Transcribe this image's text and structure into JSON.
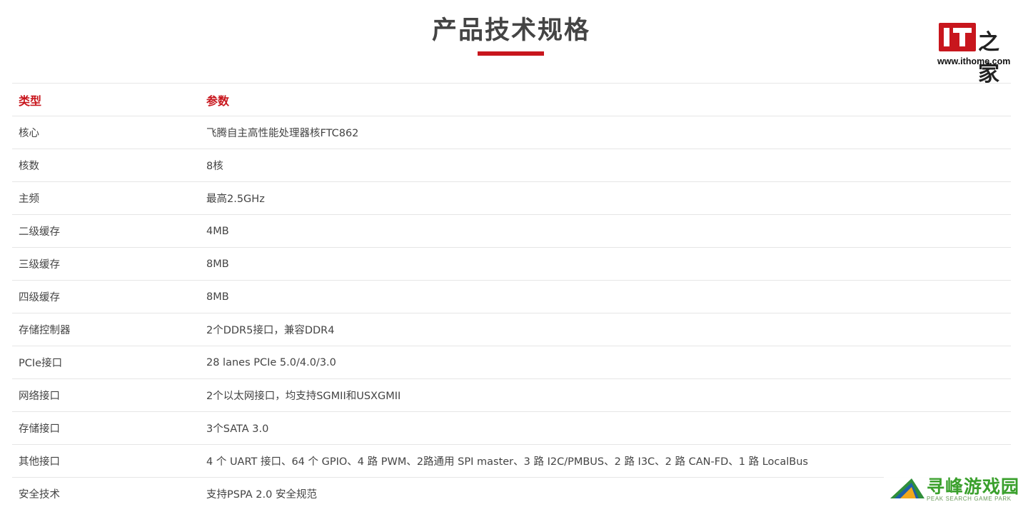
{
  "page": {
    "title": "产品技术规格"
  },
  "logo": {
    "mark_text": "IT",
    "glyphs": "之家",
    "url": "www.ithome.com",
    "brand_color": "#c8161d"
  },
  "table": {
    "headers": {
      "type": "类型",
      "param": "参数"
    },
    "rows": [
      {
        "type": "核心",
        "param": "飞腾自主高性能处理器核FTC862"
      },
      {
        "type": "核数",
        "param": "8核"
      },
      {
        "type": "主频",
        "param": "最高2.5GHz"
      },
      {
        "type": "二级缓存",
        "param": "4MB"
      },
      {
        "type": "三级缓存",
        "param": "8MB"
      },
      {
        "type": "四级缓存",
        "param": "8MB"
      },
      {
        "type": "存储控制器",
        "param": "2个DDR5接口，兼容DDR4"
      },
      {
        "type": "PCIe接口",
        "param": "28 lanes PCIe 5.0/4.0/3.0"
      },
      {
        "type": "网络接口",
        "param": "2个以太网接口，均支持SGMII和USXGMII"
      },
      {
        "type": "存储接口",
        "param": "3个SATA 3.0"
      },
      {
        "type": "其他接口",
        "param": "4 个 UART 接口、64 个 GPIO、4 路 PWM、2路通用 SPI master、3 路 I2C/PMBUS、2 路 I3C、2 路 CAN-FD、1 路 LocalBus"
      },
      {
        "type": "安全技术",
        "param": "支持PSPA 2.0 安全规范"
      }
    ]
  },
  "watermark": {
    "text": "寻峰游戏园",
    "subtext": "PEAK SEARCH GAME PARK",
    "color": "#3aa02c"
  }
}
